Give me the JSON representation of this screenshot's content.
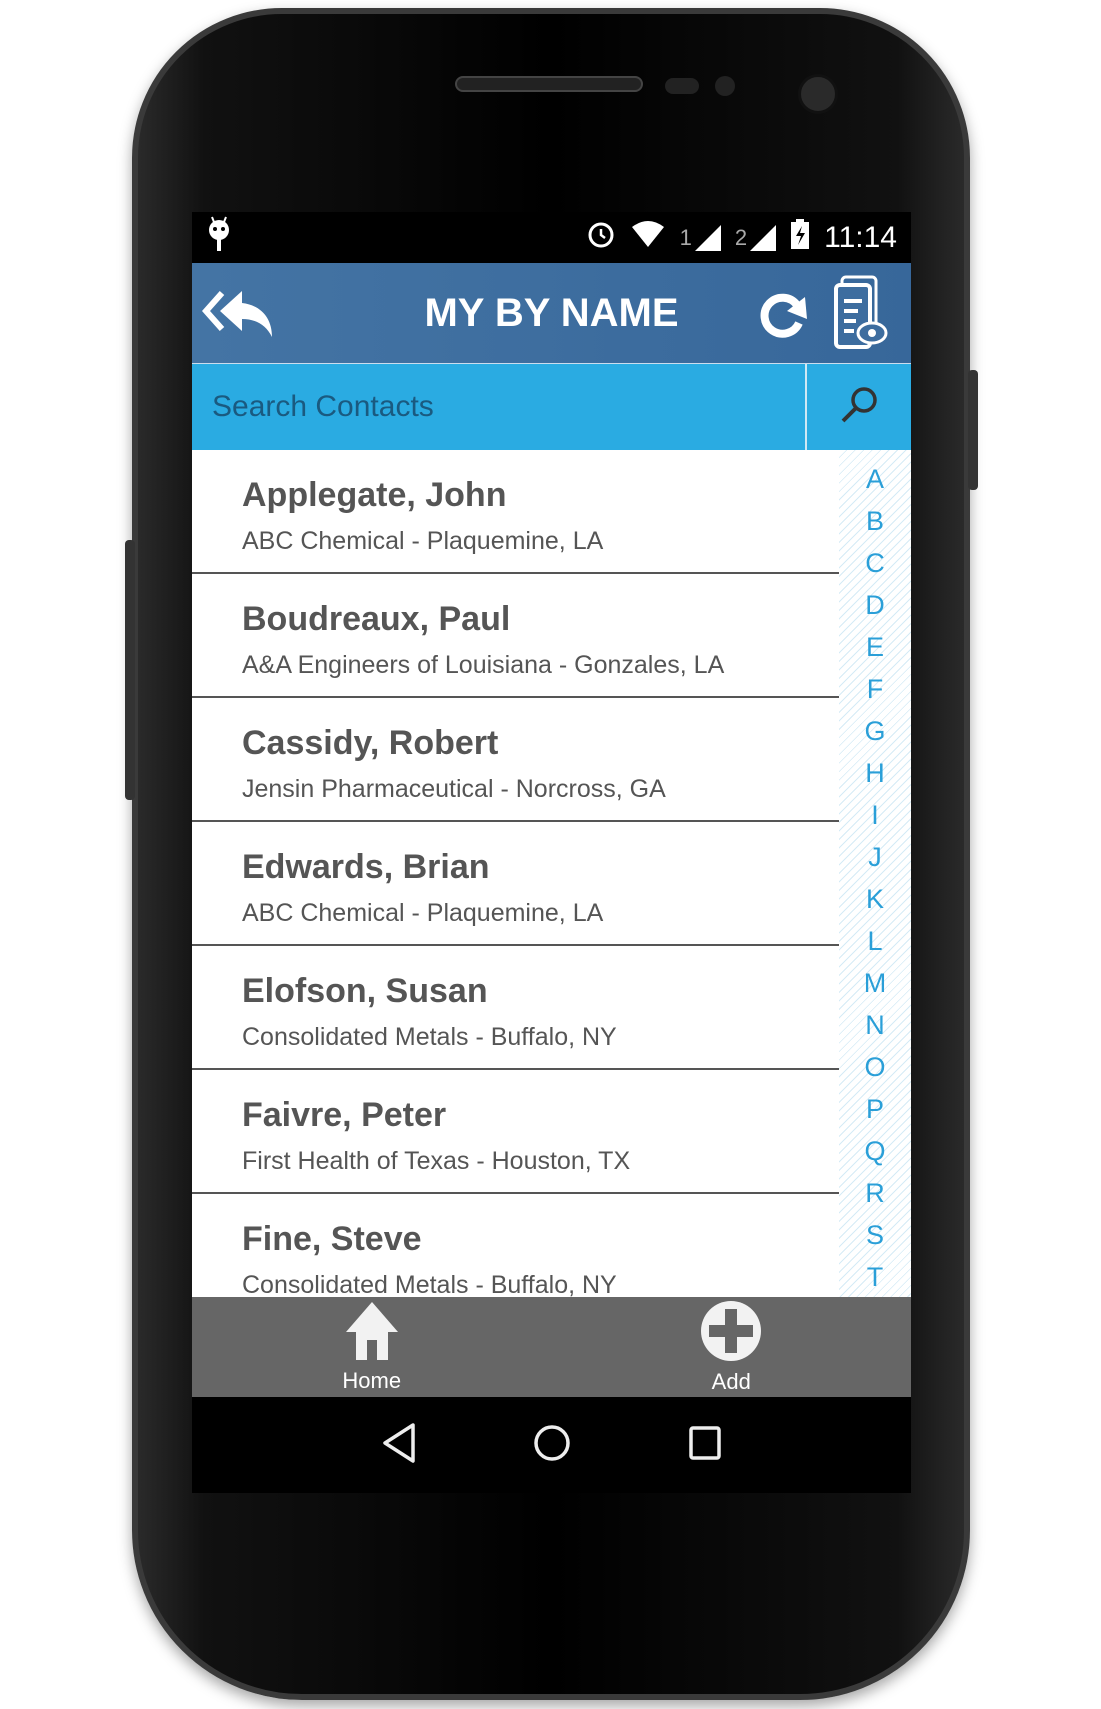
{
  "status_bar": {
    "time": "11:14",
    "sim1": "1",
    "sim2": "2"
  },
  "header": {
    "title": "MY BY NAME"
  },
  "search": {
    "placeholder": "Search Contacts"
  },
  "contacts": [
    {
      "name": "Applegate, John",
      "detail": "ABC Chemical - Plaquemine, LA"
    },
    {
      "name": "Boudreaux, Paul",
      "detail": "A&A Engineers of Louisiana - Gonzales, LA"
    },
    {
      "name": "Cassidy, Robert",
      "detail": "Jensin Pharmaceutical - Norcross, GA"
    },
    {
      "name": "Edwards, Brian",
      "detail": "ABC Chemical - Plaquemine, LA"
    },
    {
      "name": "Elofson, Susan",
      "detail": "Consolidated Metals - Buffalo, NY"
    },
    {
      "name": "Faivre, Peter",
      "detail": "First Health of Texas - Houston, TX"
    },
    {
      "name": "Fine, Steve",
      "detail": "Consolidated Metals - Buffalo, NY"
    }
  ],
  "alphabet": [
    "A",
    "B",
    "C",
    "D",
    "E",
    "F",
    "G",
    "H",
    "I",
    "J",
    "K",
    "L",
    "M",
    "N",
    "O",
    "P",
    "Q",
    "R",
    "S",
    "T"
  ],
  "bottom_bar": {
    "home": "Home",
    "add": "Add"
  },
  "colors": {
    "header": "#3d6d9f",
    "search": "#2aabe2",
    "bottom_bar": "#666666",
    "alphabet": "#2a9fd8"
  }
}
